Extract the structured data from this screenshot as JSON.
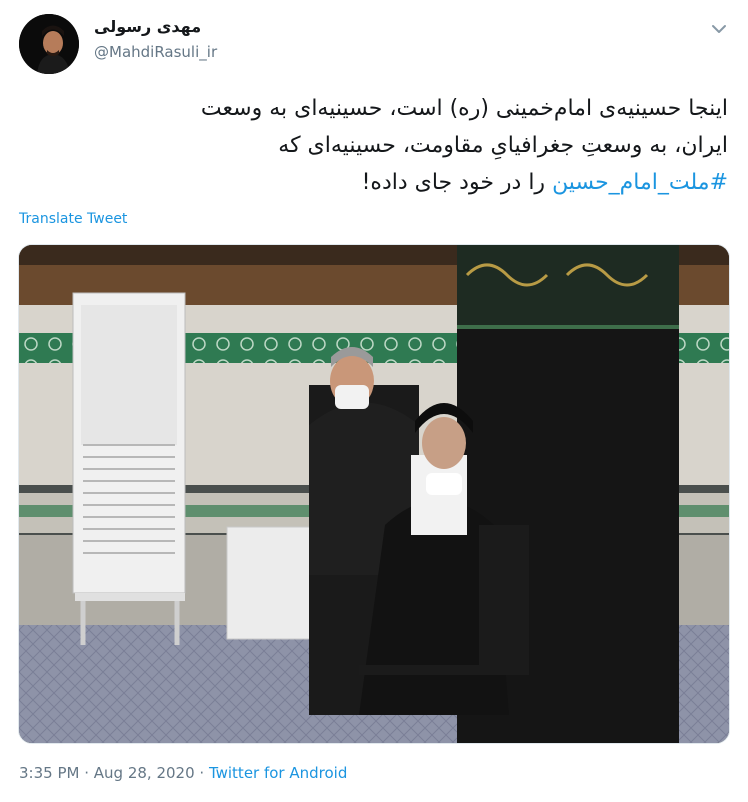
{
  "author": {
    "display_name": "مهدی رسولی",
    "handle": "@MahdiRasuli_ir"
  },
  "tweet": {
    "lines": [
      "اینجا حسینیه‌ی امام‌خمینی (ره) است، حسینیه‌ای به وسعت",
      "ایران، به وسعتِ جغرافیایِ مقاومت، حسینیه‌ای که"
    ],
    "hashtag": "#ملت_امام_حسین",
    "tail": " را در خود جای داده!"
  },
  "translate_label": "Translate Tweet",
  "footer": {
    "time": "3:35 PM",
    "separator1": " · ",
    "date": "Aug 28, 2020",
    "separator2": " · ",
    "source": "Twitter for Android"
  },
  "colors": {
    "link": "#1b95e0",
    "secondary_text": "#657786",
    "primary_text": "#14171a"
  },
  "icons": {
    "menu": "chevron-down-icon"
  }
}
